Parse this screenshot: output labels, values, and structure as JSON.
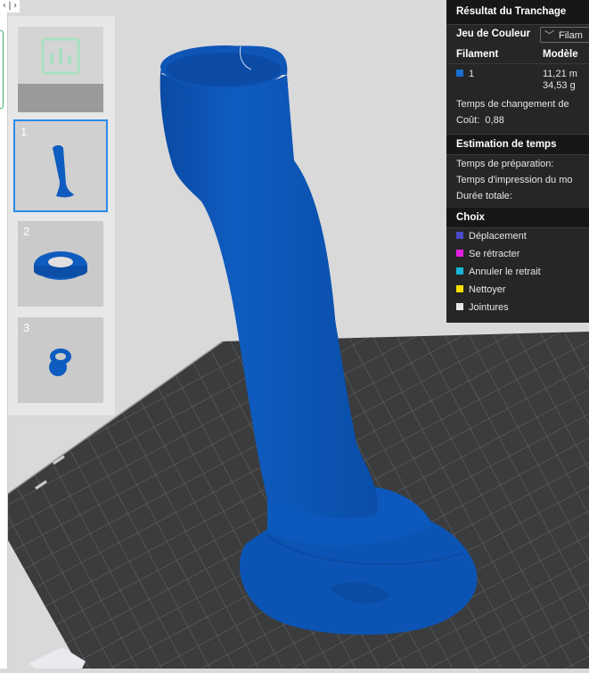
{
  "toolbar": {
    "collapse_label": "‹|›"
  },
  "plates": [
    {
      "number": "",
      "thumbnail": "empty-plate-icon",
      "selected": false
    },
    {
      "number": "1",
      "thumbnail": "vertical-tube-model",
      "selected": true
    },
    {
      "number": "2",
      "thumbnail": "ring-cap-model",
      "selected": false
    },
    {
      "number": "3",
      "thumbnail": "small-gear-model",
      "selected": false
    }
  ],
  "slice_result": {
    "title": "Résultat du Tranchage",
    "color_scheme_label": "Jeu de Couleur",
    "color_scheme_value": "Filam",
    "columns": {
      "filament": "Filament",
      "model": "Modèle"
    },
    "filament_rows": [
      {
        "index": "1",
        "length": "11,21 m",
        "weight": "34,53 g",
        "color": "#1a6fd0"
      }
    ],
    "change_time_label": "Temps de changement de",
    "cost_label": "Coût:",
    "cost_value": "0,88",
    "time_section_title": "Estimation de temps",
    "prep_time_label": "Temps de préparation:",
    "print_time_label": "Temps d'impression du mo",
    "total_time_label": "Durée totale:",
    "options_title": "Choix",
    "options": [
      {
        "label": "Déplacement",
        "color": "#4a4ac8"
      },
      {
        "label": "Se rétracter",
        "color": "#e11fe1"
      },
      {
        "label": "Annuler le retrait",
        "color": "#18b6d6"
      },
      {
        "label": "Nettoyer",
        "color": "#f7e000"
      },
      {
        "label": "Jointures",
        "color": "#e8e8e8"
      }
    ]
  },
  "colors": {
    "model_blue": "#0e57b8",
    "plate_dark": "#3a3b3c",
    "grid_line": "#6a6b6c",
    "accent": "#2a8bea"
  }
}
